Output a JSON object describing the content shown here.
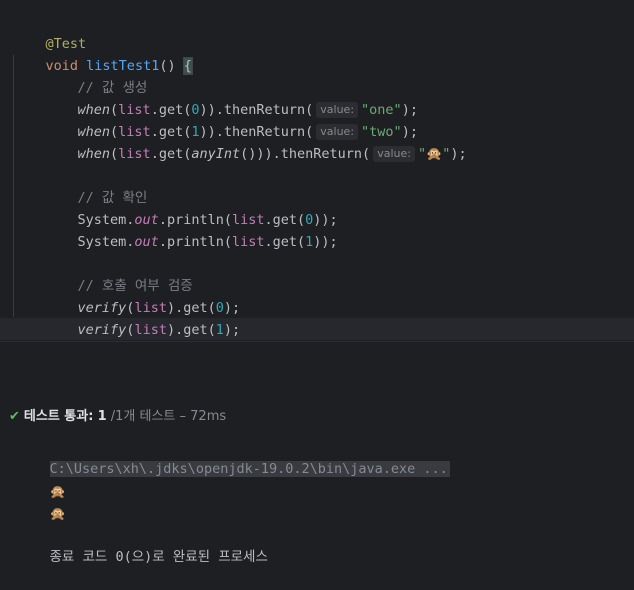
{
  "editor": {
    "annotation": "@Test",
    "signature": {
      "kw": "void",
      "name": "listTest1",
      "parens": "() ",
      "brace": "{"
    },
    "comment_create": "// 값 생성",
    "stub_lines": [
      {
        "when": "when",
        "open": "(",
        "list": "list",
        "dot_get": ".get(",
        "arg": "0",
        "close_get": "))",
        "then": ".thenReturn(",
        "hint": "value:",
        "value": "\"one\"",
        "end": ");"
      },
      {
        "when": "when",
        "open": "(",
        "list": "list",
        "dot_get": ".get(",
        "arg": "1",
        "close_get": "))",
        "then": ".thenReturn(",
        "hint": "value:",
        "value": "\"two\"",
        "end": ");"
      }
    ],
    "stub_any": {
      "when": "when",
      "open": "(",
      "list": "list",
      "dot_get": ".get(",
      "arg": "anyInt",
      "arg_close": "()",
      "close_get": "))",
      "then": ".thenReturn(",
      "hint": "value:",
      "value_open": "\"",
      "value_emoji": "🙊",
      "value_close": "\"",
      "end": ");"
    },
    "comment_check": "// 값 확인",
    "print_lines": [
      {
        "sys": "System.",
        "out": "out",
        "println": ".println(",
        "list": "list",
        "get": ".get(",
        "arg": "0",
        "end": "));"
      },
      {
        "sys": "System.",
        "out": "out",
        "println": ".println(",
        "list": "list",
        "get": ".get(",
        "arg": "1",
        "end": "));"
      }
    ],
    "comment_verify": "// 호출 여부 검증",
    "verify_lines": [
      {
        "verify": "verify",
        "open": "(",
        "list": "list",
        "close": ").get(",
        "arg": "0",
        "end": ");"
      },
      {
        "verify": "verify",
        "open": "(",
        "list": "list",
        "close": ").get(",
        "arg": "1",
        "end": ");"
      }
    ],
    "closing_brace": "}"
  },
  "run": {
    "status_label": "테스트 통과:",
    "passed": "1",
    "total": "/1개 테스트 – 72ms",
    "check_icon": "check-icon"
  },
  "console": {
    "command": "C:\\Users\\xh\\.jdks\\openjdk-19.0.2\\bin\\java.exe ...",
    "output_1": "🙊",
    "output_2": "🙊",
    "exit_message": "종료 코드 0(으)로 완료된 프로세스"
  },
  "colors": {
    "background": "#1e1f22",
    "keyword": "#cf8e6d",
    "function": "#56a8f5",
    "string": "#6aab73",
    "number": "#2aacb8",
    "pass": "#5fb865"
  }
}
